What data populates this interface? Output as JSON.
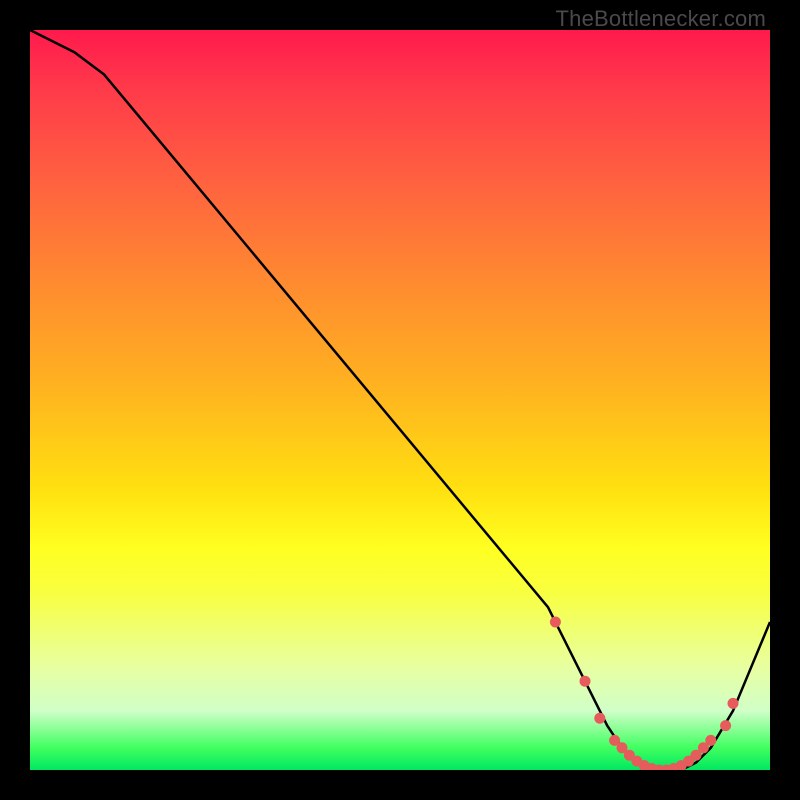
{
  "watermark": "TheBottlenecker.com",
  "colors": {
    "line": "#000000",
    "marker": "#e65c5c"
  },
  "chart_data": {
    "type": "line",
    "title": "",
    "xlabel": "",
    "ylabel": "",
    "xlim": [
      0,
      100
    ],
    "ylim": [
      0,
      100
    ],
    "x": [
      0,
      6,
      10,
      20,
      30,
      40,
      50,
      60,
      70,
      75,
      78,
      80,
      82,
      84,
      86,
      88,
      90,
      92,
      95,
      100
    ],
    "values": [
      100,
      97,
      94,
      82,
      70,
      58,
      46,
      34,
      22,
      12,
      6,
      3,
      1,
      0,
      0,
      0,
      1,
      3,
      8,
      20
    ],
    "markers": {
      "x": [
        71,
        75,
        77,
        79,
        80,
        81,
        82,
        83,
        84,
        85,
        86,
        87,
        88,
        89,
        90,
        91,
        92,
        94,
        95
      ],
      "values": [
        20,
        12,
        7,
        4,
        3,
        2,
        1.2,
        0.6,
        0.2,
        0,
        0,
        0.2,
        0.6,
        1.2,
        2,
        3,
        4,
        6,
        9
      ]
    }
  }
}
